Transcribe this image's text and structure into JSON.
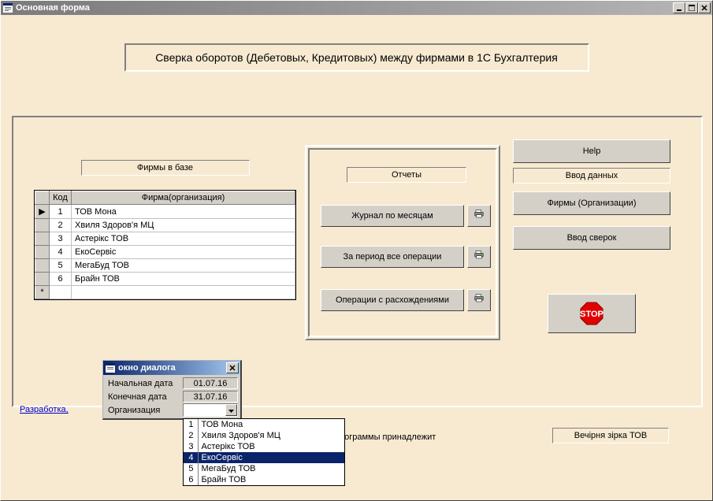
{
  "window": {
    "title": "Основная форма"
  },
  "header": {
    "text": "Сверка оборотов (Дебетовых, Кредитовых) между фирмами в 1С Бухгалтерия"
  },
  "firms": {
    "label": "Фирмы в базе",
    "columns": {
      "code": "Код",
      "name": "Фирма(организация)"
    },
    "rows": [
      {
        "code": "1",
        "name": "ТОВ Мона"
      },
      {
        "code": "2",
        "name": "Хвиля Здоров'я МЦ"
      },
      {
        "code": "3",
        "name": "Астерікс ТОВ"
      },
      {
        "code": "4",
        "name": "ЕкоСервіс"
      },
      {
        "code": "5",
        "name": "МегаБуд ТОВ"
      },
      {
        "code": "6",
        "name": "Брайн ТОВ"
      }
    ]
  },
  "reports": {
    "label": "Отчеты",
    "btn1": "Журнал по месяцам",
    "btn2": "За период все операции",
    "btn3": "Операции с расхождениями"
  },
  "right": {
    "help": "Help",
    "data_entry_label": "Ввод данных",
    "firms_btn": "Фирмы (Организации)",
    "checks_btn": "Ввод сверок"
  },
  "footer": {
    "dev_link": "Разработка,",
    "rights_label": "я программы принадлежит",
    "rights_owner": "Вечірня зірка ТОВ"
  },
  "dialog": {
    "title": "окно диалога",
    "start_label": "Начальная дата",
    "start_val": "01.07.16",
    "end_label": "Конечная дата",
    "end_val": "31.07.16",
    "org_label": "Организация"
  },
  "dropdown": {
    "items": [
      {
        "n": "1",
        "t": "ТОВ Мона"
      },
      {
        "n": "2",
        "t": "Хвиля Здоров'я МЦ"
      },
      {
        "n": "3",
        "t": "Астерікс ТОВ"
      },
      {
        "n": "4",
        "t": "ЕкоСервіс"
      },
      {
        "n": "5",
        "t": "МегаБуд ТОВ"
      },
      {
        "n": "6",
        "t": "Брайн ТОВ"
      }
    ],
    "highlighted": 3
  }
}
